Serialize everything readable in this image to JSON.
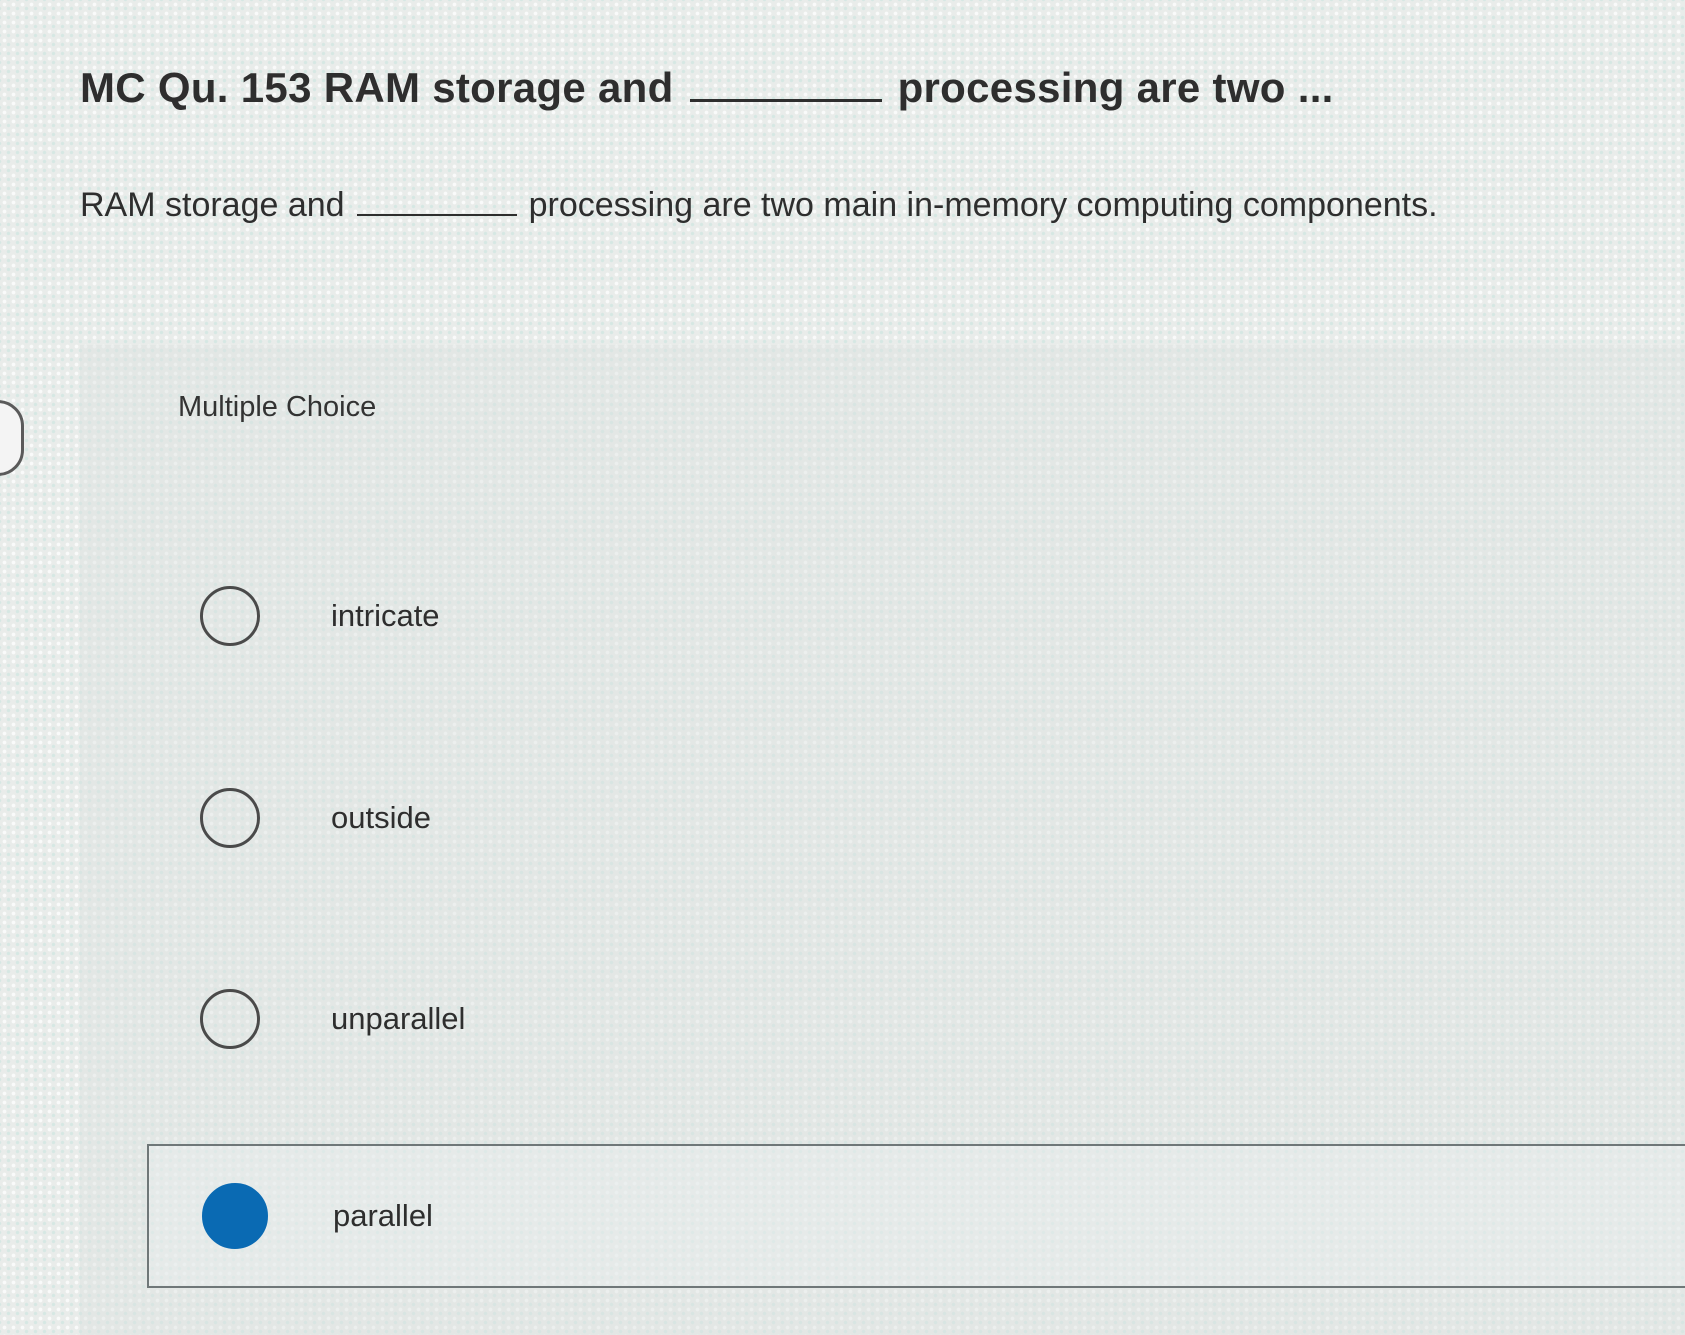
{
  "question": {
    "title_prefix": "MC Qu. 153 RAM storage and",
    "title_suffix": "processing are two ...",
    "text_prefix": "RAM storage and",
    "text_suffix": "processing are two main in-memory computing components."
  },
  "panel": {
    "label": "Multiple Choice"
  },
  "options": [
    {
      "label": "intricate",
      "selected": false
    },
    {
      "label": "outside",
      "selected": false
    },
    {
      "label": "unparallel",
      "selected": false
    },
    {
      "label": "parallel",
      "selected": true
    }
  ],
  "colors": {
    "selected_radio": "#0a6ab3"
  }
}
